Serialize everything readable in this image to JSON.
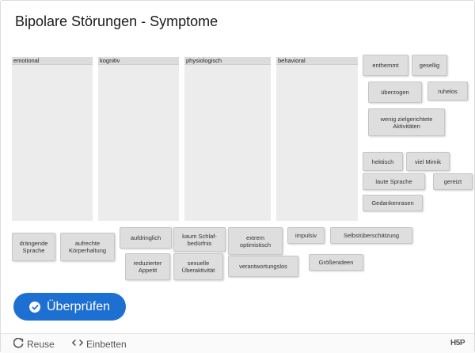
{
  "title": "Bipolare Störungen - Symptome",
  "zones": [
    {
      "label": "emotional"
    },
    {
      "label": "kognitiv"
    },
    {
      "label": "physiologisch"
    },
    {
      "label": "behavioral"
    }
  ],
  "tiles": [
    {
      "text": "enthemmt"
    },
    {
      "text": "gesellig"
    },
    {
      "text": "überzogen"
    },
    {
      "text": "ruhelos"
    },
    {
      "text": "wenig zielgerichtete\nAktivitäten"
    },
    {
      "text": "hektisch"
    },
    {
      "text": "viel Mimik"
    },
    {
      "text": "laute Sprache"
    },
    {
      "text": "gereizt"
    },
    {
      "text": "Gedankenrasen"
    },
    {
      "text": "drängende\nSprache"
    },
    {
      "text": "aufrechte\nKörperhaltung"
    },
    {
      "text": "aufdringlich"
    },
    {
      "text": "kaum Schlaf-\nbedürfnis"
    },
    {
      "text": "extrem\noptimistisch"
    },
    {
      "text": "impulsiv"
    },
    {
      "text": "Selbstüberschätzung"
    },
    {
      "text": "reduzierter\nAppetit"
    },
    {
      "text": "sexuelle\nÜberaktivität"
    },
    {
      "text": "verantwortungslos"
    },
    {
      "text": "Größenideen"
    }
  ],
  "check_button": {
    "label": "Überprüfen",
    "icon": "check-circle-icon"
  },
  "footer": {
    "reuse_label": "Reuse",
    "embed_label": "Einbetten",
    "logo_text": "H5P"
  }
}
